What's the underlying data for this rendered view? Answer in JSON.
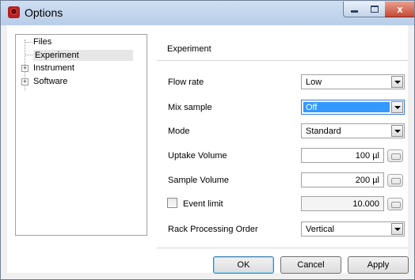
{
  "window": {
    "title": "Options",
    "close_glyph": "x"
  },
  "tree": {
    "items": [
      {
        "label": "Files",
        "expandable": false
      },
      {
        "label": "Experiment",
        "expandable": false,
        "selected": true
      },
      {
        "label": "Instrument",
        "expandable": true,
        "expander": "+"
      },
      {
        "label": "Software",
        "expandable": true,
        "expander": "+"
      }
    ]
  },
  "panel": {
    "heading": "Experiment",
    "fields": {
      "flow_rate": {
        "label": "Flow rate",
        "value": "Low"
      },
      "mix_sample": {
        "label": "Mix sample",
        "value": "Off"
      },
      "mode": {
        "label": "Mode",
        "value": "Standard"
      },
      "uptake_volume": {
        "label": "Uptake Volume",
        "value": "100 µl"
      },
      "sample_volume": {
        "label": "Sample Volume",
        "value": "200 µl"
      },
      "event_limit": {
        "label": "Event limit",
        "checked": false,
        "value": "10.000"
      },
      "rack_order": {
        "label": "Rack Processing Order",
        "value": "Vertical"
      }
    }
  },
  "buttons": {
    "ok": "OK",
    "cancel": "Cancel",
    "apply": "Apply"
  },
  "colors": {
    "selection": "#3399ff",
    "title_bar": "#c8daf0",
    "close_button": "#c74a35"
  }
}
